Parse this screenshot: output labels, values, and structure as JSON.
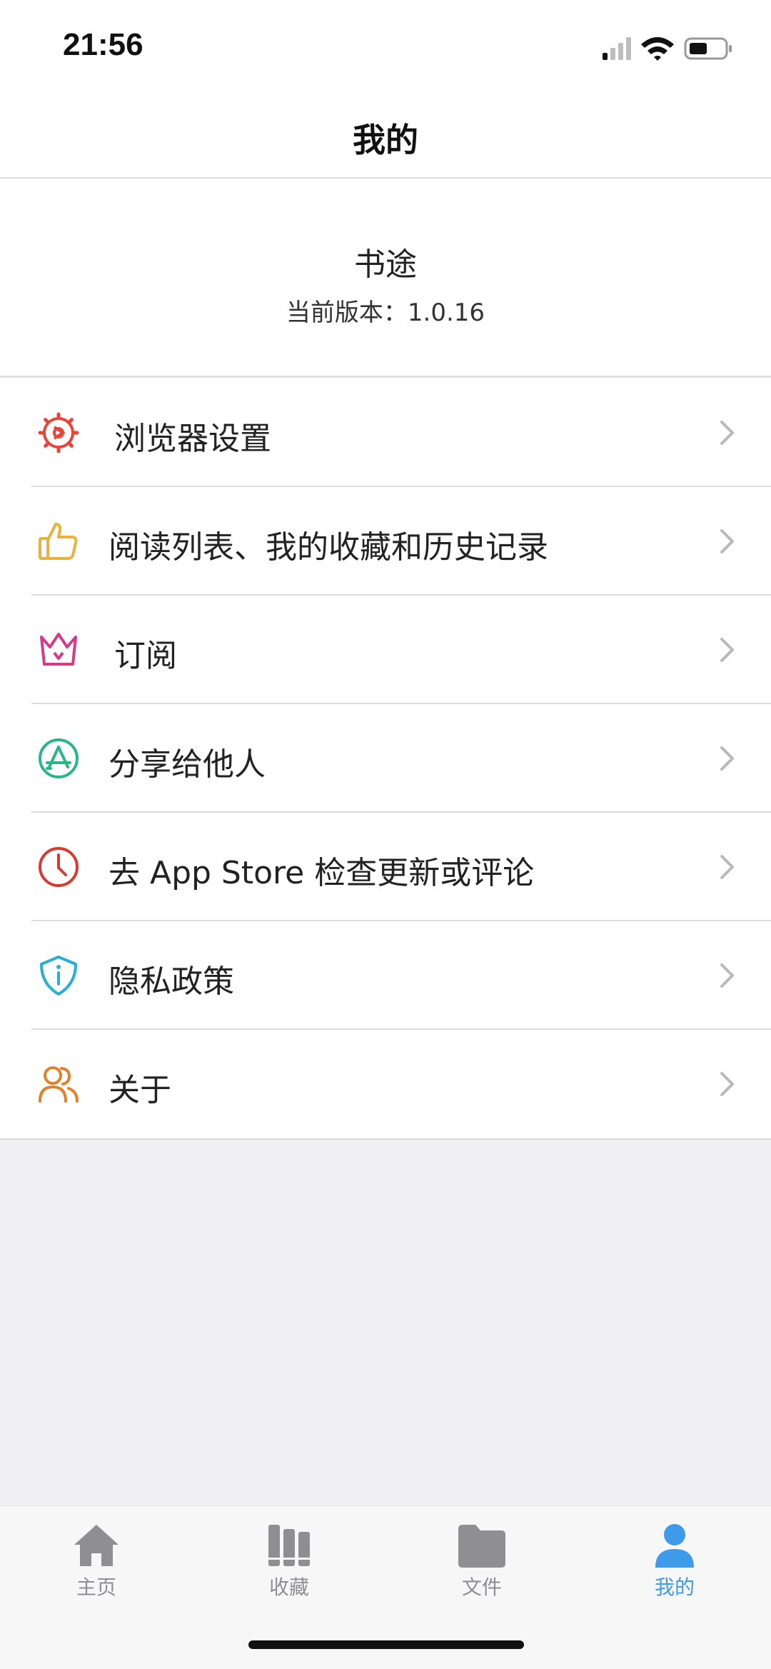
{
  "status_bar": {
    "time": "21:56"
  },
  "nav": {
    "title": "我的"
  },
  "app_info": {
    "name": "书途",
    "version_text": "当前版本：1.0.16"
  },
  "menu": {
    "items": [
      {
        "label": "浏览器设置",
        "icon": "settings-gear-icon",
        "color": "#e8443a"
      },
      {
        "label": "阅读列表、我的收藏和历史记录",
        "icon": "thumbs-up-icon",
        "color": "#e8b23a"
      },
      {
        "label": "订阅",
        "icon": "crown-icon",
        "color": "#d6398a"
      },
      {
        "label": "分享给他人",
        "icon": "app-store-icon",
        "color": "#2bb58c"
      },
      {
        "label": "去 App Store 检查更新或评论",
        "icon": "clock-icon",
        "color": "#d93a30"
      },
      {
        "label": "隐私政策",
        "icon": "shield-info-icon",
        "color": "#2aaed6"
      },
      {
        "label": "关于",
        "icon": "users-icon",
        "color": "#e0812c"
      }
    ]
  },
  "tabs": [
    {
      "label": "主页",
      "icon": "home-icon"
    },
    {
      "label": "收藏",
      "icon": "books-icon"
    },
    {
      "label": "文件",
      "icon": "folder-icon"
    },
    {
      "label": "我的",
      "icon": "person-icon",
      "active": true
    }
  ],
  "colors": {
    "accent": "#3d9be9",
    "tab_inactive": "#8e8e93",
    "background": "#f0eff4"
  }
}
